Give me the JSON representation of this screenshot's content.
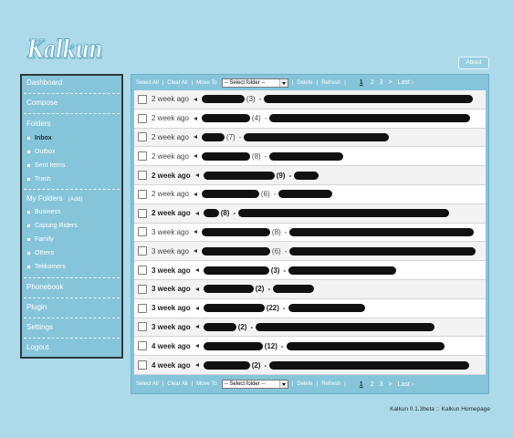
{
  "app": {
    "logo_text": "Kalkun"
  },
  "header": {
    "about_label": "About"
  },
  "colors": {
    "page_bg": "#acdaea",
    "panel_bg": "#86c4da",
    "sidebar_border": "#2c3a3f",
    "text_dark": "#1e2a2e",
    "redaction": "#111111"
  },
  "sidebar": {
    "dashboard": "Dashboard",
    "compose": "Compose",
    "folders": {
      "label": "Folders",
      "items": [
        {
          "label": "Inbox",
          "active": true
        },
        {
          "label": "Outbox",
          "active": false
        },
        {
          "label": "Sent Items",
          "active": false
        },
        {
          "label": "Trash",
          "active": false
        }
      ]
    },
    "my_folders": {
      "label": "My Folders",
      "add_label": "(Add)",
      "items": [
        {
          "label": "Business"
        },
        {
          "label": "Capung Riders"
        },
        {
          "label": "Family"
        },
        {
          "label": "Others"
        },
        {
          "label": "Tekkomers"
        }
      ]
    },
    "phonebook": "Phonebook",
    "plugin": "Plugin",
    "settings": "Settings",
    "logout": "Logout",
    "bullet_icon": "square-bullet-icon"
  },
  "toolbar": {
    "select_all": "Select All",
    "clear_all": "Clear All",
    "move_to": "Move To",
    "folder_select": "-- Select folder --",
    "delete": "Delete",
    "refresh": "Refresh",
    "separator": "|",
    "pagination": {
      "current": "1",
      "pages": [
        "2",
        "3"
      ],
      "next": ">",
      "last": "Last ›"
    }
  },
  "messages": {
    "separator": "-",
    "direction_icon": "incoming-arrow-icon",
    "rows": [
      {
        "date": "2 week ago",
        "unread": false,
        "count": "(3)"
      },
      {
        "date": "2 week ago",
        "unread": false,
        "count": "(4)"
      },
      {
        "date": "2 week ago",
        "unread": false,
        "count": "(7)"
      },
      {
        "date": "2 week ago",
        "unread": false,
        "count": "(8)"
      },
      {
        "date": "2 week ago",
        "unread": true,
        "count": "(9)"
      },
      {
        "date": "2 week ago",
        "unread": false,
        "count": "(6)"
      },
      {
        "date": "2 week ago",
        "unread": true,
        "count": "(8)"
      },
      {
        "date": "3 week ago",
        "unread": false,
        "count": "(8)"
      },
      {
        "date": "3 week ago",
        "unread": false,
        "count": "(6)"
      },
      {
        "date": "3 week ago",
        "unread": true,
        "count": "(3)"
      },
      {
        "date": "3 week ago",
        "unread": true,
        "count": "(2)"
      },
      {
        "date": "3 week ago",
        "unread": true,
        "count": "(22)"
      },
      {
        "date": "3 week ago",
        "unread": true,
        "count": "(2)"
      },
      {
        "date": "4 week ago",
        "unread": true,
        "count": "(12)"
      },
      {
        "date": "4 week ago",
        "unread": true,
        "count": "(2)"
      }
    ]
  },
  "footer": {
    "version": "Kalkun 0.1.3beta",
    "divider": "::",
    "homepage_link": "Kalkun Homepage"
  }
}
